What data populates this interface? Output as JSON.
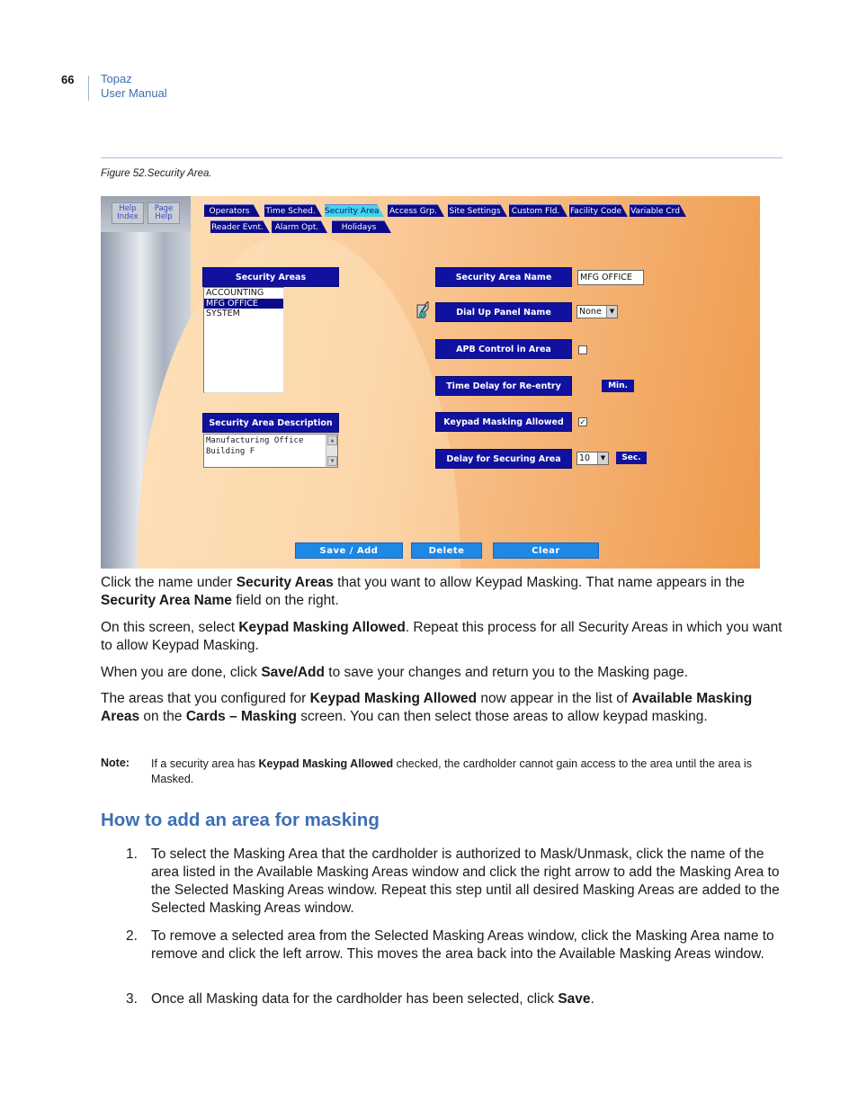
{
  "header": {
    "page_number": "66",
    "product": "Topaz",
    "doc": "User Manual"
  },
  "figure": {
    "caption": "Figure 52.Security Area.",
    "help_buttons": [
      {
        "line1": "Help",
        "line2": "Index"
      },
      {
        "line1": "Page",
        "line2": "Help"
      }
    ],
    "tabs_row1": [
      "Operators",
      "Time Sched.",
      "Security Area",
      "Access Grp.",
      "Site Settings",
      "Custom Fld.",
      "Facility Code",
      "Variable Crd"
    ],
    "tabs_row2": [
      "Reader Evnt.",
      "Alarm Opt.",
      "Holidays"
    ],
    "active_tab": "Security Area",
    "security_areas_label": "Security Areas",
    "security_areas": [
      "ACCOUNTING",
      "MFG OFFICE",
      "SYSTEM"
    ],
    "selected_area": "MFG OFFICE",
    "description_label": "Security Area Description",
    "description_lines": [
      "Manufacturing Office",
      "Building F"
    ],
    "fields": {
      "name_label": "Security Area Name",
      "name_value": "MFG OFFICE",
      "dialup_label": "Dial Up Panel Name",
      "dialup_value": "None",
      "apb_label": "APB Control in Area",
      "apb_checked": false,
      "delay_reentry_label": "Time Delay for Re-entry",
      "delay_reentry_unit": "Min.",
      "keypad_label": "Keypad Masking Allowed",
      "keypad_checked": true,
      "keypad_check_glyph": "✓",
      "securing_label": "Delay for Securing Area",
      "securing_value": "10",
      "securing_unit": "Sec."
    },
    "dropdown_glyph": "▼",
    "buttons": {
      "save": "Save / Add",
      "delete": "Delete",
      "clear": "Clear"
    },
    "colors": {
      "label_bg": "#1111a0",
      "active_tab": "#3dd8e6",
      "action_btn": "#1e88e5"
    }
  },
  "body": {
    "p1": [
      {
        "t": "Click the name under "
      },
      {
        "b": "Security Areas"
      },
      {
        "t": " that you want to allow Keypad Masking. That name appears in the "
      },
      {
        "b": "Security Area Name"
      },
      {
        "t": " field on the right."
      }
    ],
    "p2": [
      {
        "t": "On this screen, select "
      },
      {
        "b": "Keypad Masking Allowed"
      },
      {
        "t": ". Repeat this process for all Security Areas in which you want to allow Keypad Masking."
      }
    ],
    "p3": [
      {
        "t": "When you are done, click "
      },
      {
        "b": "Save/Add"
      },
      {
        "t": " to save your changes and return you to the Masking page."
      }
    ],
    "p4": [
      {
        "t": "The areas that you configured for "
      },
      {
        "b": "Keypad Masking Allowed"
      },
      {
        "t": " now appear in the list of "
      },
      {
        "b": "Available Masking Areas"
      },
      {
        "t": " on the "
      },
      {
        "b": "Cards – Masking"
      },
      {
        "t": " screen. You can then select those areas to allow keypad masking."
      }
    ],
    "note_label": "Note:",
    "note": [
      {
        "t": "If a security area has "
      },
      {
        "b": "Keypad Masking Allowed"
      },
      {
        "t": " checked, the cardholder cannot gain access to the area until the area is Masked."
      }
    ],
    "heading": "How to add an area for masking",
    "steps": [
      {
        "num": "1.",
        "parts": [
          {
            "t": "To select the Masking Area that the cardholder is authorized to Mask/Unmask, click the name of the area listed in the Available Masking Areas window and click the right arrow to add the Masking Area to the Selected Masking Areas window. Repeat this step until all desired Masking Areas are added to the Selected Masking Areas window."
          }
        ]
      },
      {
        "num": "2.",
        "parts": [
          {
            "t": "To remove a selected area from the Selected Masking Areas window, click the Masking Area name to remove and click the left arrow. This moves the area back into the Available Masking Areas window."
          }
        ]
      },
      {
        "num": "3.",
        "parts": [
          {
            "t": "Once all Masking data for the cardholder has been selected, click "
          },
          {
            "b": "Save"
          },
          {
            "t": "."
          }
        ]
      }
    ]
  }
}
